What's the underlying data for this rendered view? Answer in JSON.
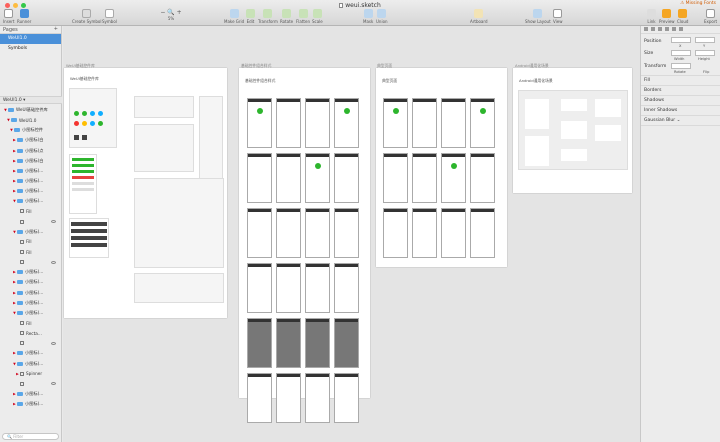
{
  "window": {
    "title": "weui.sketch",
    "missing_fonts": "Missing Fonts"
  },
  "toolbar": {
    "left": [
      {
        "label": "Insert"
      },
      {
        "label": "Runner"
      }
    ],
    "mid": [
      {
        "label": "Create Symbol"
      },
      {
        "label": "Symbol"
      }
    ],
    "zoom": "5%",
    "tools": [
      {
        "label": "Make Grid"
      },
      {
        "label": "Edit"
      },
      {
        "label": "Transform"
      },
      {
        "label": "Rotate"
      },
      {
        "label": "Flatten"
      },
      {
        "label": "Scale"
      },
      {
        "label": "Mask"
      },
      {
        "label": "Union"
      },
      {
        "label": "Artboard"
      },
      {
        "label": "Show Layout"
      },
      {
        "label": "View"
      },
      {
        "label": "Link"
      },
      {
        "label": "Preview"
      },
      {
        "label": "Cloud"
      },
      {
        "label": "Export"
      }
    ]
  },
  "pages": {
    "header": "Pages",
    "items": [
      "WeUI1.0",
      "Symbols"
    ]
  },
  "layers": {
    "header": "WeUI1.0",
    "filter_placeholder": "Filter",
    "rows": [
      {
        "label": "WeUI基础控件库",
        "indent": 1,
        "type": "board",
        "arrow": "▼"
      },
      {
        "label": "WeUI1.0",
        "indent": 2,
        "type": "folder",
        "arrow": "▼"
      },
      {
        "label": "小图标控件",
        "indent": 3,
        "type": "folder",
        "arrow": "▼"
      },
      {
        "label": "小图标(白",
        "indent": 4,
        "type": "folder",
        "arrow": "▶"
      },
      {
        "label": "小图标(点",
        "indent": 4,
        "type": "folder",
        "arrow": "▶"
      },
      {
        "label": "小图标(白",
        "indent": 4,
        "type": "folder",
        "arrow": "▶"
      },
      {
        "label": "小图标(…",
        "indent": 4,
        "type": "folder",
        "arrow": "▶"
      },
      {
        "label": "小图标(…",
        "indent": 4,
        "type": "folder",
        "arrow": "▶"
      },
      {
        "label": "小图标(…",
        "indent": 4,
        "type": "folder",
        "arrow": "▶"
      },
      {
        "label": "小图标(…",
        "indent": 4,
        "type": "folder",
        "arrow": "▼"
      },
      {
        "label": "Fill",
        "indent": 5,
        "type": "shape",
        "arrow": ""
      },
      {
        "label": "",
        "indent": 5,
        "type": "check",
        "arrow": ""
      },
      {
        "label": "小图标(…",
        "indent": 4,
        "type": "folder",
        "arrow": "▼"
      },
      {
        "label": "Fill",
        "indent": 5,
        "type": "shape",
        "arrow": ""
      },
      {
        "label": "Fill",
        "indent": 5,
        "type": "shape",
        "arrow": ""
      },
      {
        "label": "",
        "indent": 5,
        "type": "check",
        "arrow": ""
      },
      {
        "label": "小图标(…",
        "indent": 4,
        "type": "folder",
        "arrow": "▶"
      },
      {
        "label": "小图标(…",
        "indent": 4,
        "type": "folder",
        "arrow": "▶"
      },
      {
        "label": "小图标(…",
        "indent": 4,
        "type": "folder",
        "arrow": "▶"
      },
      {
        "label": "小图标(…",
        "indent": 4,
        "type": "folder",
        "arrow": "▶"
      },
      {
        "label": "小图标(…",
        "indent": 4,
        "type": "folder",
        "arrow": "▼"
      },
      {
        "label": "Fill",
        "indent": 5,
        "type": "shape",
        "arrow": ""
      },
      {
        "label": "Recta…",
        "indent": 5,
        "type": "shape",
        "arrow": ""
      },
      {
        "label": "",
        "indent": 5,
        "type": "check",
        "arrow": ""
      },
      {
        "label": "小图标(…",
        "indent": 4,
        "type": "folder",
        "arrow": "▶"
      },
      {
        "label": "小图标(…",
        "indent": 4,
        "type": "folder",
        "arrow": "▼"
      },
      {
        "label": "Spinner",
        "indent": 5,
        "type": "shape",
        "arrow": "▶"
      },
      {
        "label": "",
        "indent": 5,
        "type": "check",
        "arrow": ""
      },
      {
        "label": "小图标(…",
        "indent": 4,
        "type": "folder",
        "arrow": "▶"
      },
      {
        "label": "小图标(…",
        "indent": 4,
        "type": "folder",
        "arrow": "▶"
      }
    ]
  },
  "artboards": [
    {
      "label": "WeUI基础控件库",
      "title": "WeUI基础控件库"
    },
    {
      "label": "基础控件组合样式",
      "title": "基础控件组合样式"
    },
    {
      "label": "典型页面",
      "title": "典型页面"
    },
    {
      "label": "Android通用化场景",
      "title": "Android通用化场景"
    }
  ],
  "inspector": {
    "sections": [
      "Position",
      "Size",
      "Transform",
      "Fill",
      "Borders",
      "Shadows",
      "Inner Shadows",
      "Gaussian Blur"
    ],
    "xy": [
      "X",
      "Y"
    ],
    "wh": [
      "Width",
      "Height"
    ],
    "rf": [
      "Rotate",
      "Flip"
    ]
  },
  "colors": {
    "selection": "#4a90d9",
    "accent_green": "#2db52d",
    "missing": "#d05a00"
  }
}
